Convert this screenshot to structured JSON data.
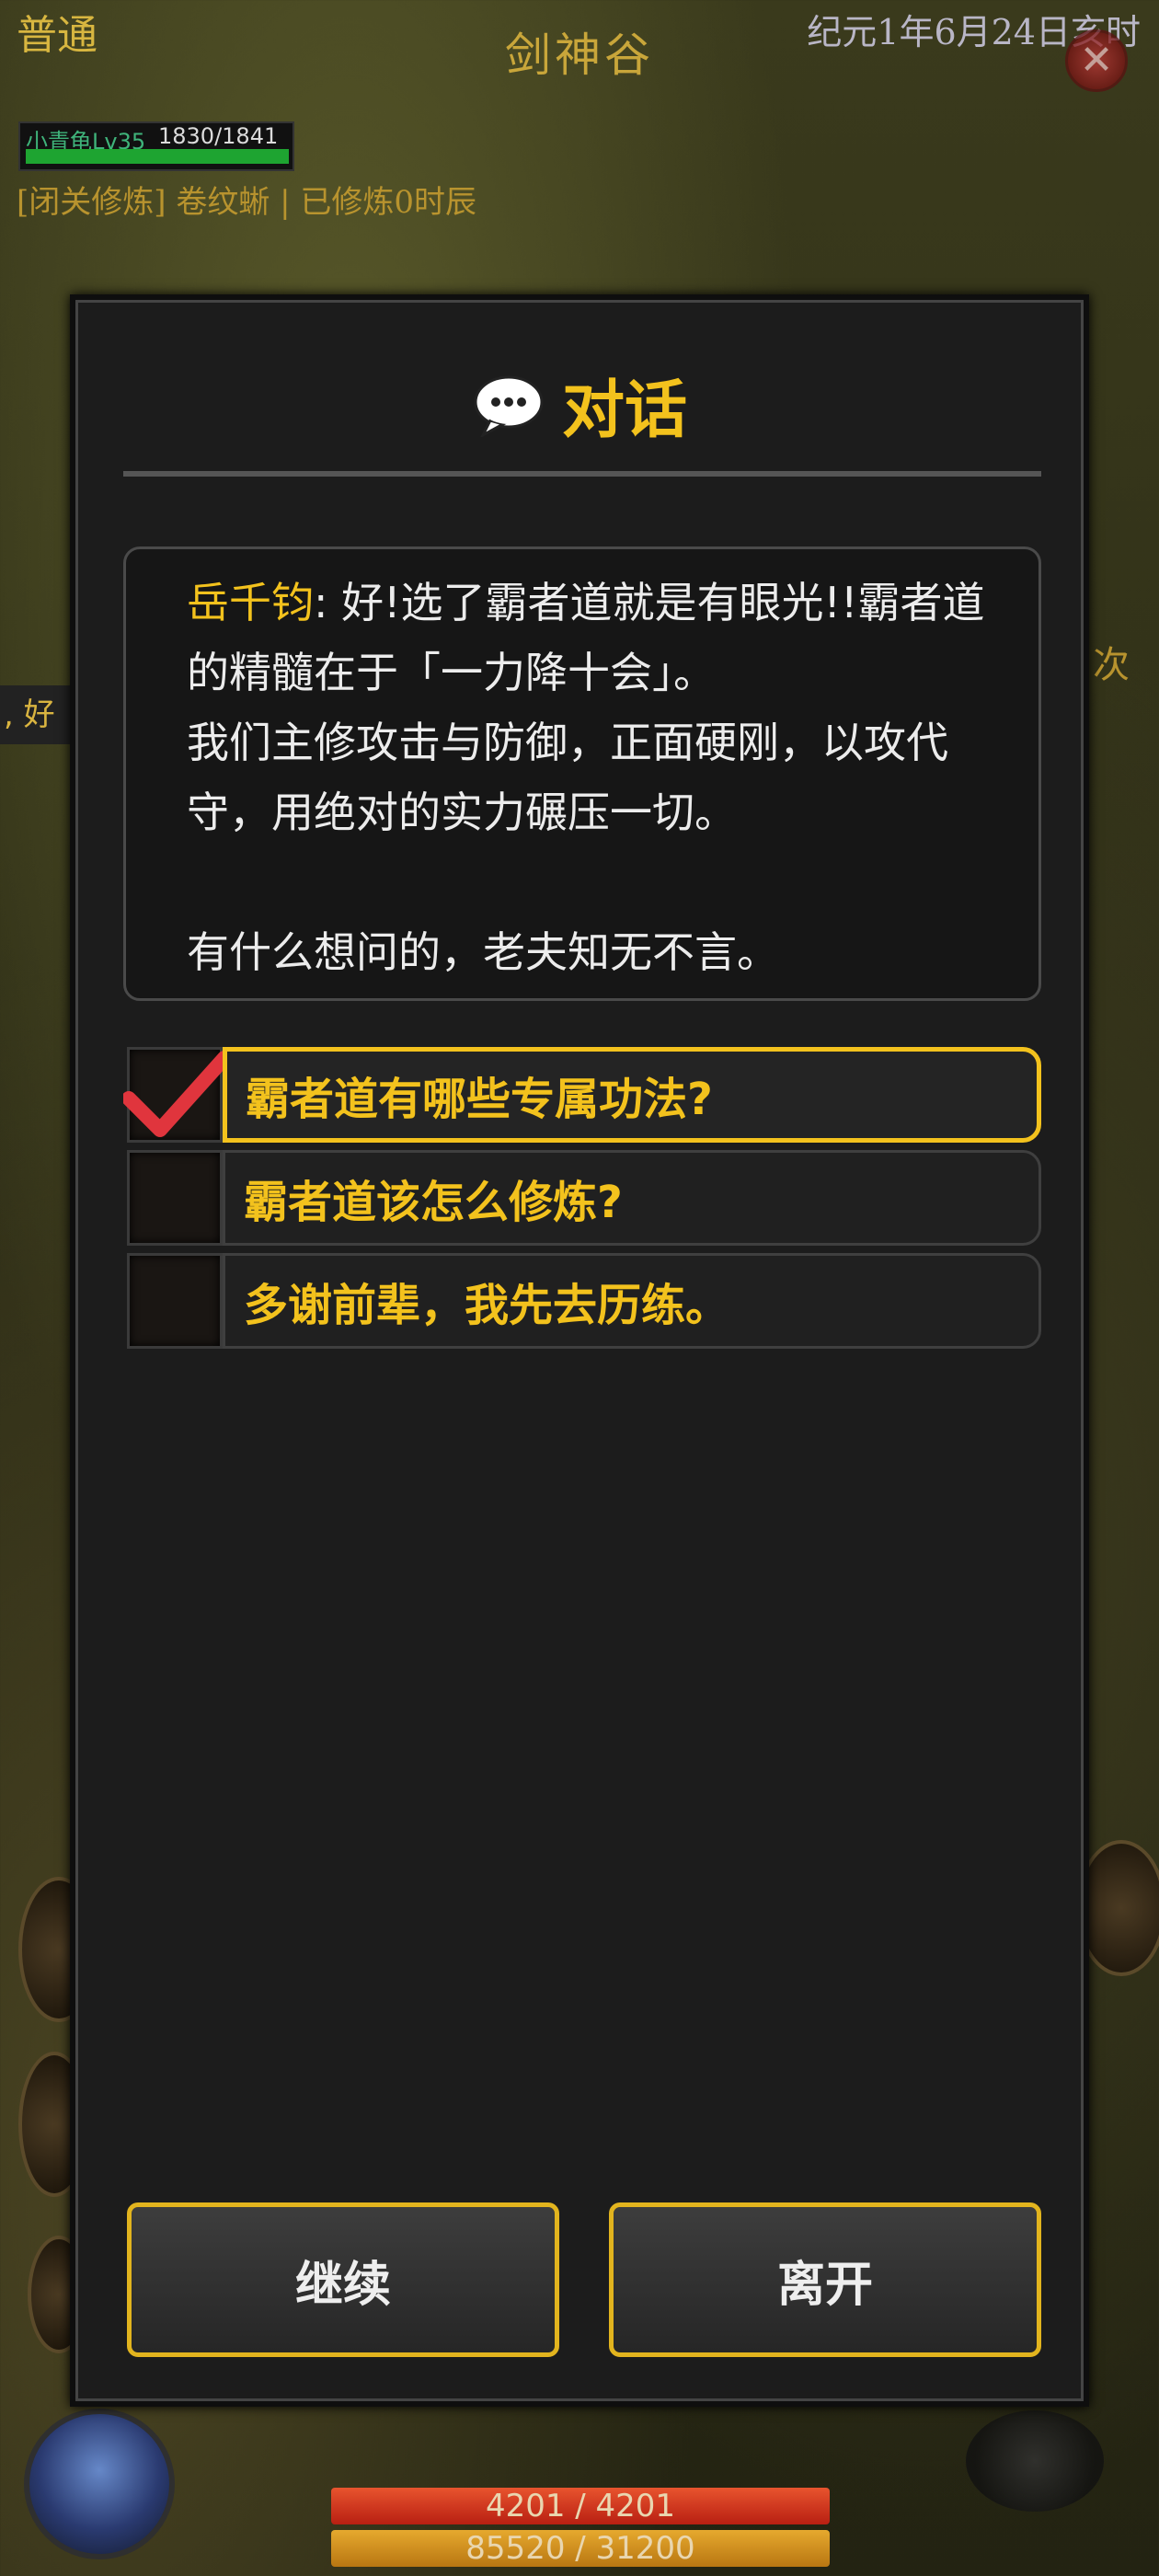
{
  "header": {
    "mode": "普通",
    "location": "剑神谷",
    "date": "纪元1年6月24日亥时"
  },
  "player": {
    "name_level": "小青龟Lv35",
    "hp_text": "1830/1841",
    "cultivation_status": "[闭关修炼] 卷纹蜥 | 已修炼0时辰"
  },
  "side": {
    "left_fragment": ", 好",
    "right_fragment": "次"
  },
  "dialog": {
    "title": "对话",
    "speaker": "岳千钧",
    "message": ": 好!选了霸者道就是有眼光!!霸者道的精髓在于「一力降十会」。\n我们主修攻击与防御，正面硬刚，以攻代守，用绝对的实力碾压一切。\n\n有什么想问的，老夫知无不言。",
    "options": [
      {
        "label": "霸者道有哪些专属功法?",
        "selected": true
      },
      {
        "label": "霸者道该怎么修炼?",
        "selected": false
      },
      {
        "label": "多谢前辈，我先去历练。",
        "selected": false
      }
    ],
    "continue_label": "继续",
    "leave_label": "离开"
  },
  "bottom": {
    "hp": "4201  /  4201",
    "exp": "85520  /  31200"
  },
  "icons": {
    "chat": "speech-bubble-icon",
    "close": "close-icon",
    "check": "checkmark-icon"
  },
  "colors": {
    "accent": "#f3c21d",
    "dialog_bg": "#1c1c1c",
    "check": "#e0353d"
  }
}
